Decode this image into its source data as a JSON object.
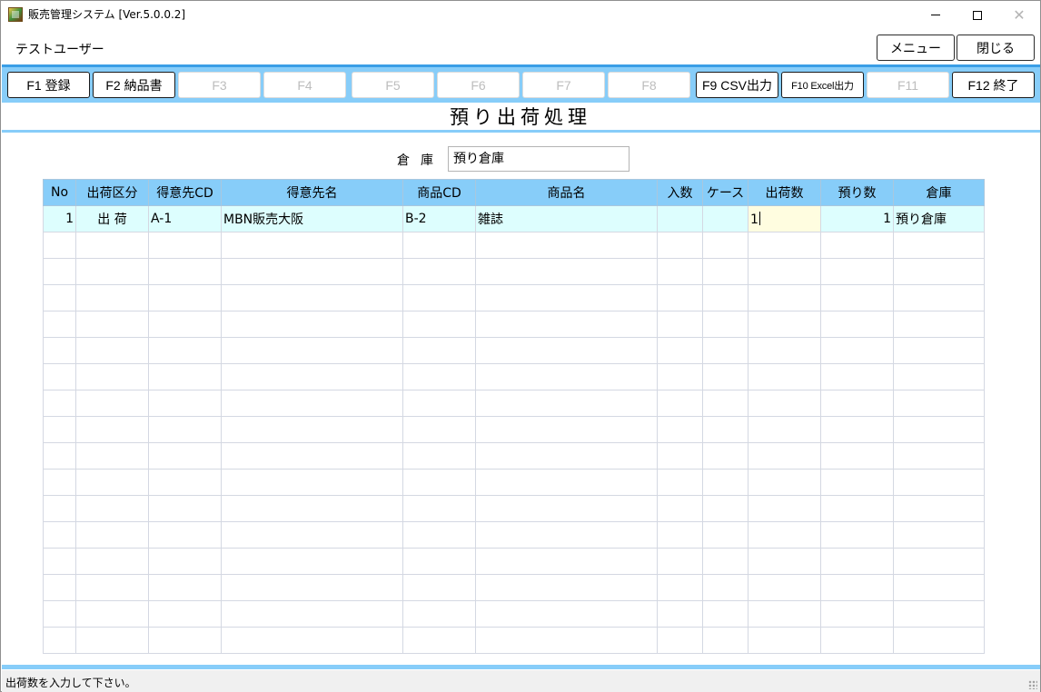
{
  "window": {
    "title": "販売管理システム [Ver.5.0.0.2]"
  },
  "header": {
    "user_name": "テストユーザー",
    "menu_label": "メニュー",
    "close_label": "閉じる"
  },
  "function_keys": [
    {
      "label": "F1 登録",
      "enabled": true
    },
    {
      "label": "F2 納品書",
      "enabled": true
    },
    {
      "label": "F3",
      "enabled": false
    },
    {
      "label": "F4",
      "enabled": false
    },
    {
      "label": "F5",
      "enabled": false
    },
    {
      "label": "F6",
      "enabled": false
    },
    {
      "label": "F7",
      "enabled": false
    },
    {
      "label": "F8",
      "enabled": false
    },
    {
      "label": "F9 CSV出力",
      "enabled": true
    },
    {
      "label": "F10 Excel出力",
      "enabled": true
    },
    {
      "label": "F11",
      "enabled": false
    },
    {
      "label": "F12 終了",
      "enabled": true
    }
  ],
  "page": {
    "title": "預り出荷処理",
    "warehouse_label": "倉庫",
    "warehouse_value": "預り倉庫"
  },
  "grid": {
    "columns": [
      "No",
      "出荷区分",
      "得意先CD",
      "得意先名",
      "商品CD",
      "商品名",
      "入数",
      "ケース",
      "出荷数",
      "預り数",
      "倉庫"
    ],
    "rows": [
      [
        "1",
        "出 荷",
        "A-1",
        "MBN販売大阪",
        "B-2",
        "雑誌",
        "",
        "",
        "1",
        "1",
        "預り倉庫"
      ]
    ],
    "empty_row_count": 16
  },
  "status": {
    "message": "出荷数を入力して下さい。"
  }
}
